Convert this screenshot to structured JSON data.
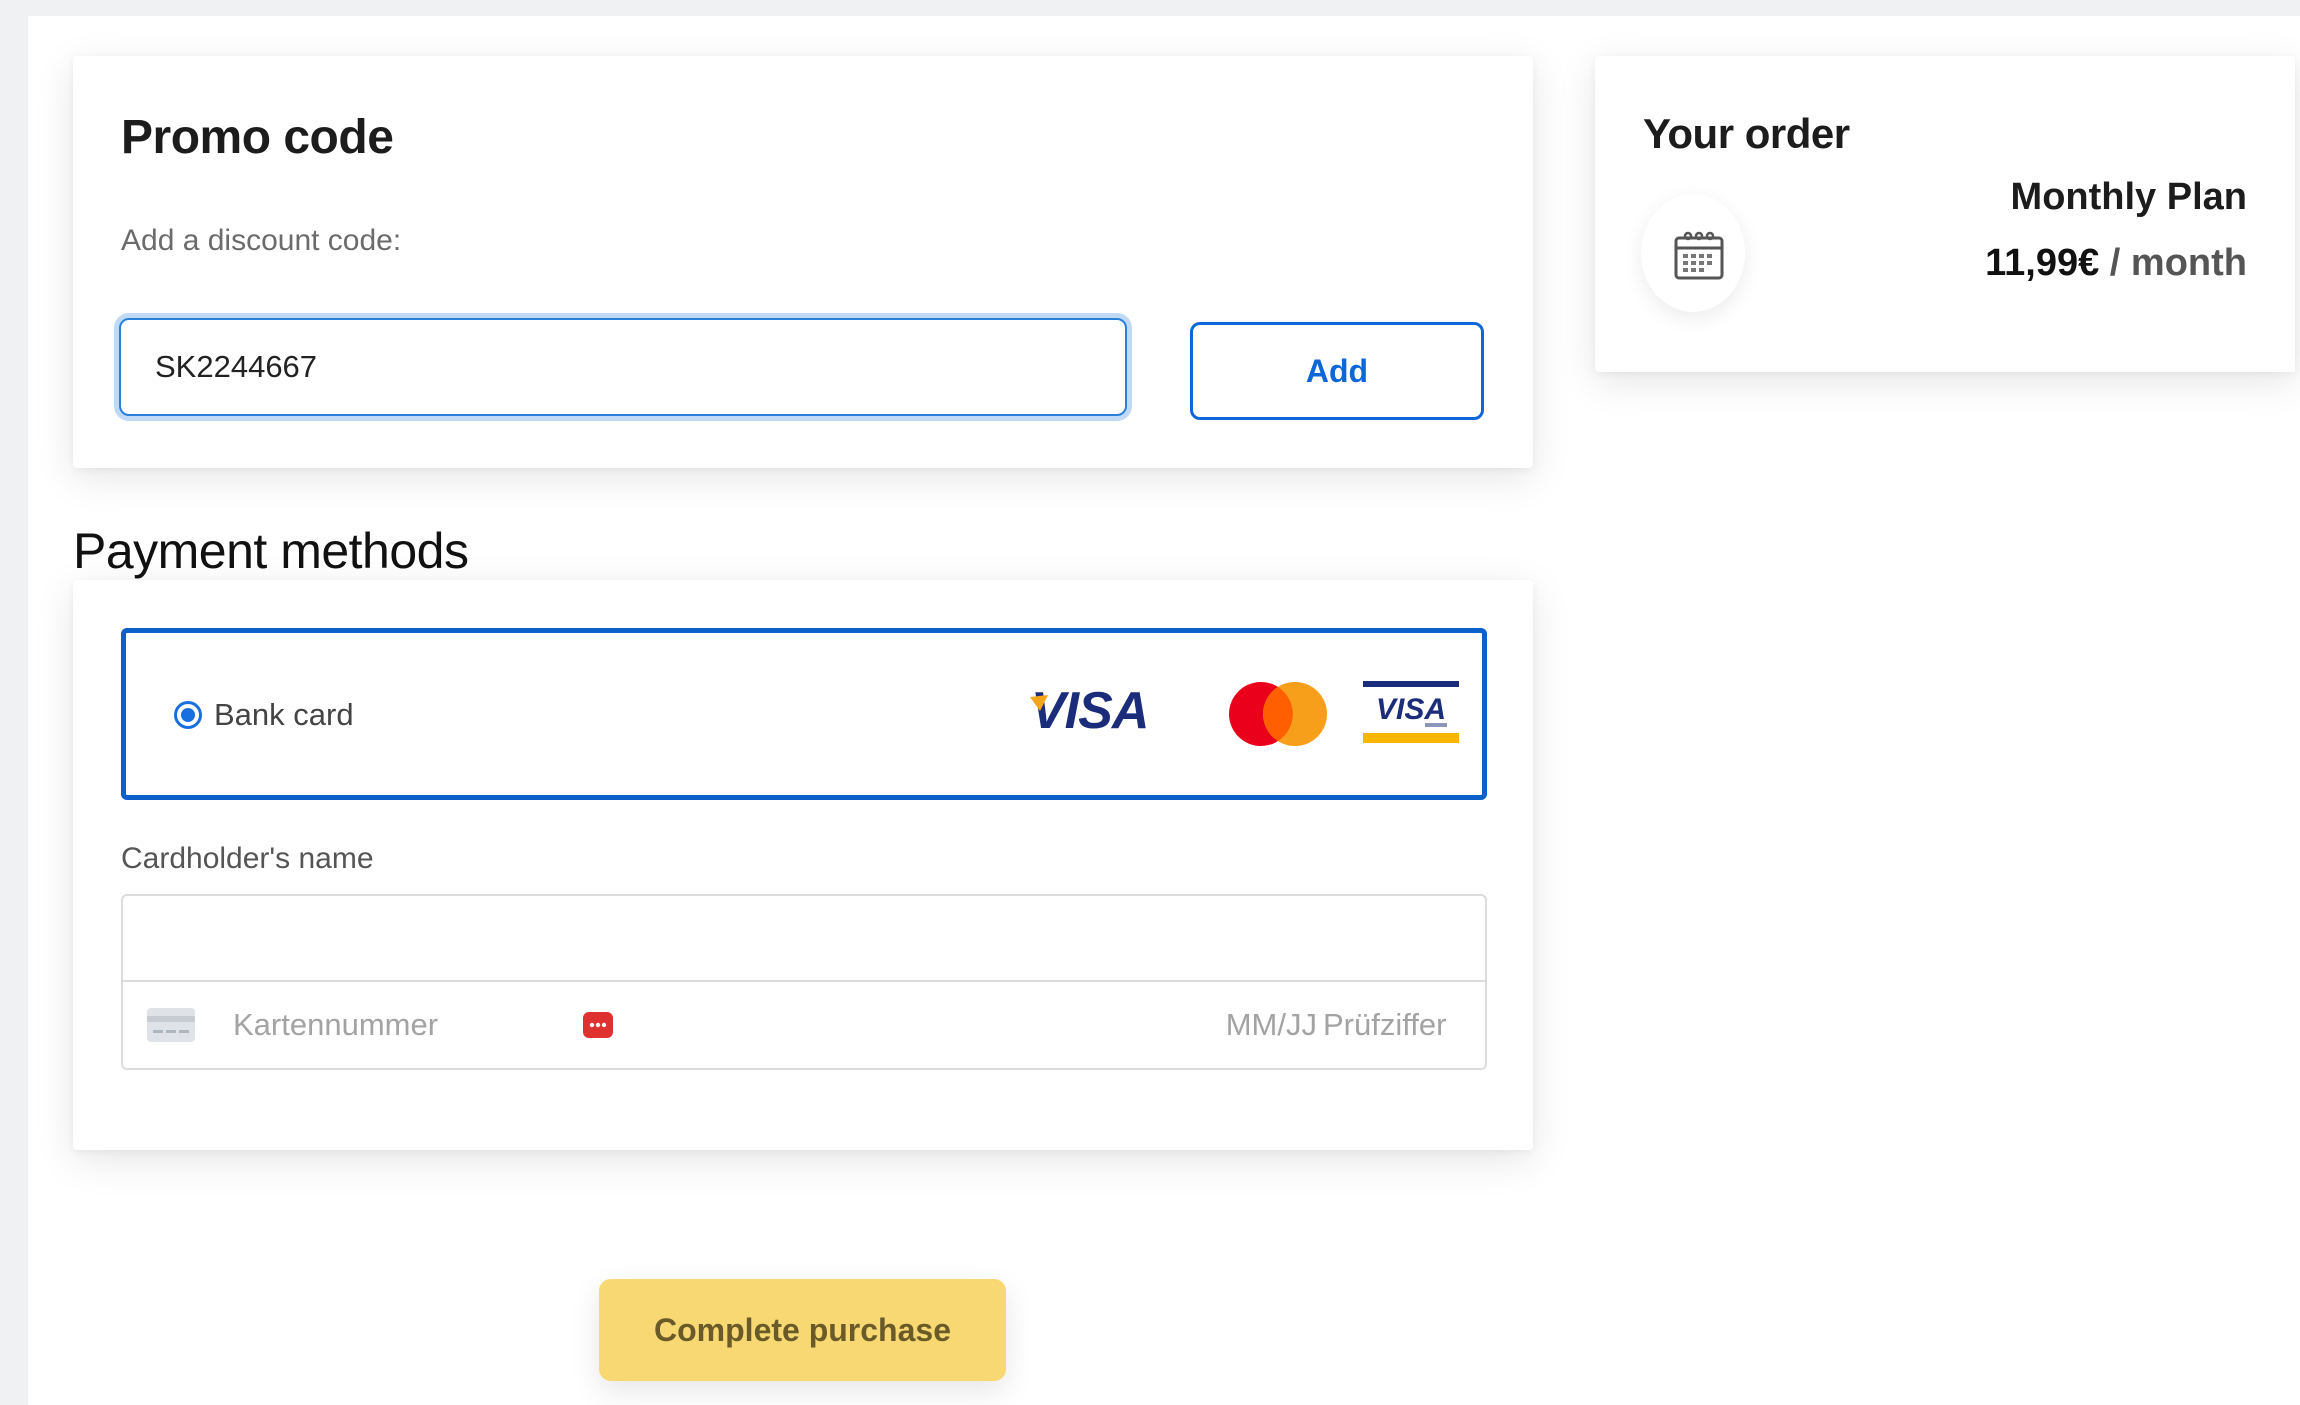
{
  "promo": {
    "title": "Promo code",
    "label": "Add a discount code:",
    "code_value": "SK2244667",
    "add_label": "Add"
  },
  "payment": {
    "heading": "Payment methods",
    "method_label": "Bank card",
    "brand_logos": [
      "visa-logo",
      "mastercard-logo",
      "visa-electron-logo"
    ],
    "cardholder_label": "Cardholder's name",
    "cardholder_value": "",
    "card_number_placeholder": "Kartennummer",
    "expiry_placeholder": "MM/JJ",
    "cvc_placeholder": "Prüfziffer"
  },
  "actions": {
    "complete_label": "Complete purchase"
  },
  "order": {
    "title": "Your order",
    "plan_name": "Monthly Plan",
    "price": "11,99€",
    "period": "/ month"
  },
  "colors": {
    "accent_blue": "#0d5fc9",
    "add_button_blue": "#0d67d9",
    "complete_yellow": "#f7d873",
    "visa_navy": "#1a2c7a"
  }
}
